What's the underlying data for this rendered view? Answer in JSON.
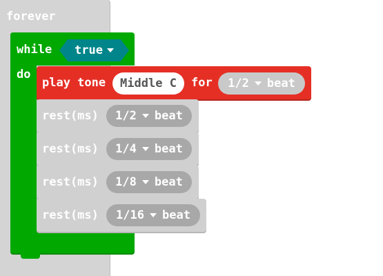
{
  "forever": {
    "label": "forever"
  },
  "while": {
    "label": "while",
    "do_label": "do",
    "condition": "true"
  },
  "play_tone": {
    "label": "play tone",
    "note": "Middle C",
    "for_label": "for",
    "duration": {
      "value": "1/2",
      "unit": "beat"
    }
  },
  "rests": [
    {
      "label": "rest(ms)",
      "value": "1/2",
      "unit": "beat"
    },
    {
      "label": "rest(ms)",
      "value": "1/4",
      "unit": "beat"
    },
    {
      "label": "rest(ms)",
      "value": "1/8",
      "unit": "beat"
    },
    {
      "label": "rest(ms)",
      "value": "1/16",
      "unit": "beat"
    }
  ],
  "colors": {
    "loops": "#00a800",
    "logic": "#00858a",
    "music": "#e52f25",
    "basic": "#d4d4d4"
  }
}
